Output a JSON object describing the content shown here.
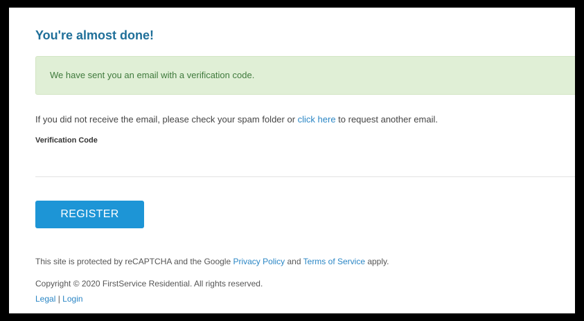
{
  "page": {
    "title": "You're almost done!"
  },
  "alert": {
    "message": "We have sent you an email with a verification code."
  },
  "info": {
    "prefix": "If you did not receive the email, please check your spam folder or ",
    "link": "click here",
    "suffix": " to request another email."
  },
  "form": {
    "verification_label": "Verification Code"
  },
  "actions": {
    "register_label": "REGISTER"
  },
  "footer": {
    "recaptcha_prefix": "This site is protected by reCAPTCHA and the Google ",
    "privacy_link": "Privacy Policy",
    "recaptcha_and": " and ",
    "terms_link": "Terms of Service",
    "recaptcha_suffix": " apply.",
    "copyright": "Copyright © 2020 FirstService Residential. All rights reserved.",
    "legal_link": "Legal",
    "separator": " | ",
    "login_link": "Login"
  },
  "colors": {
    "title": "#1f6f99",
    "alert_bg": "#e0efd6",
    "alert_text": "#3f7a3c",
    "link": "#2a86c5",
    "button": "#1d95d6"
  }
}
